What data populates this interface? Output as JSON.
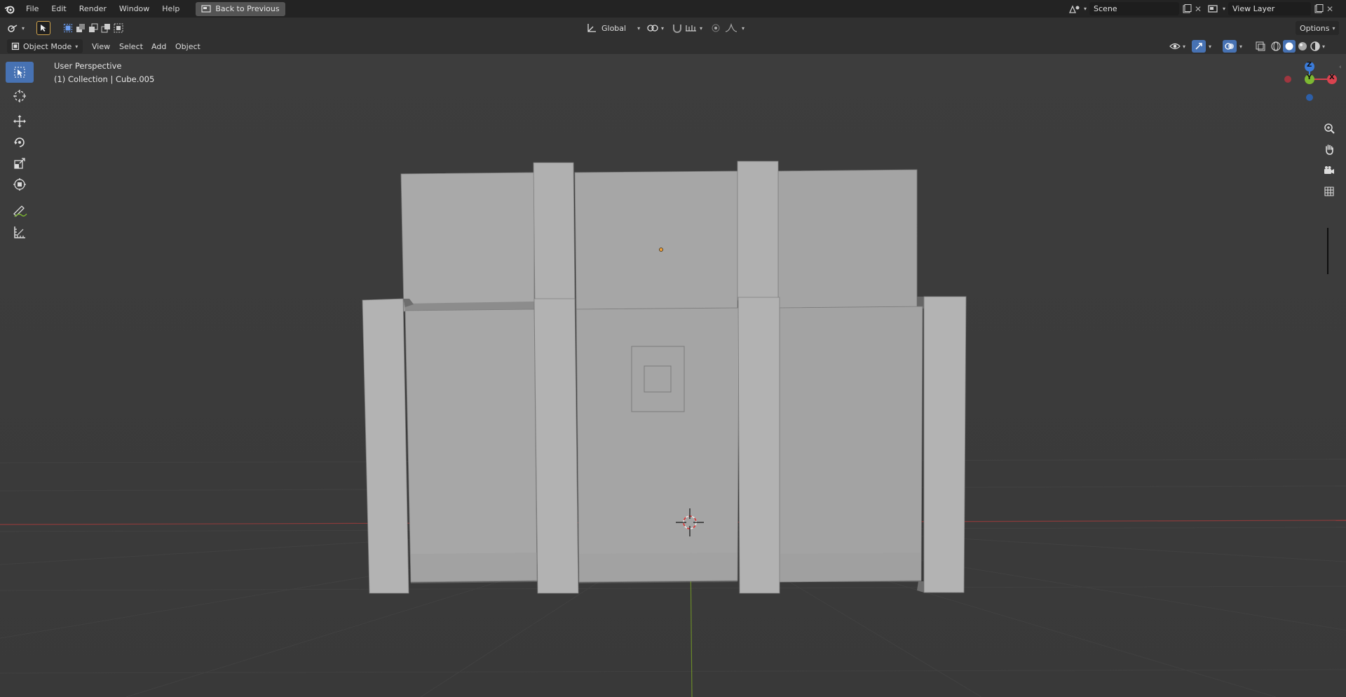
{
  "menu": {
    "file": "File",
    "edit": "Edit",
    "render": "Render",
    "window": "Window",
    "help": "Help",
    "back_to_previous": "Back to Previous"
  },
  "scene": {
    "label": "Scene"
  },
  "view_layer": {
    "label": "View Layer"
  },
  "header": {
    "transform_orientation": "Global",
    "options": "Options"
  },
  "viewport_header": {
    "mode": "Object Mode",
    "view": "View",
    "select": "Select",
    "add": "Add",
    "object": "Object"
  },
  "overlay": {
    "perspective": "User Perspective",
    "collection": "(1) Collection | Cube.005"
  },
  "gizmo": {
    "z": "Z",
    "y": "Y",
    "x": "X"
  },
  "colors": {
    "active_tool": "#4772b3",
    "x_axis": "#d9434f",
    "y_axis": "#7db832",
    "z_axis": "#3b7bd9"
  },
  "icons": [
    "blender-logo-icon",
    "select-box-icon",
    "cursor-icon",
    "move-icon",
    "rotate-icon",
    "scale-icon",
    "transform-icon",
    "annotate-icon",
    "measure-icon",
    "zoom-icon",
    "hand-icon",
    "camera-icon",
    "grid-icon"
  ]
}
